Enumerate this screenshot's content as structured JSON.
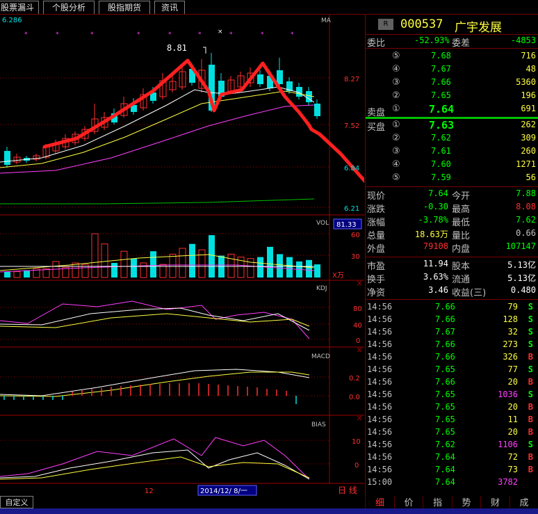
{
  "tabs": [
    "股票漏斗",
    "个股分析",
    "股指期货",
    "资讯"
  ],
  "chart": {
    "top_left_price": "6.286",
    "ma_label": "MA",
    "high_marker": "8.81",
    "y_prices": [
      "8.27",
      "7.52",
      "6.84",
      "6.21"
    ],
    "vol_label": "VOL",
    "vol_value": "81.33",
    "vol_ticks": [
      "60",
      "30"
    ],
    "vol_unit": "X万",
    "kdj_label": "KDJ",
    "kdj_ticks": [
      "80",
      "40",
      "0"
    ],
    "macd_label": "MACD",
    "macd_ticks": [
      "0.2",
      "0.0"
    ],
    "bias_label": "BIAS",
    "bias_ticks": [
      "10",
      "0"
    ],
    "x_label_mid": "12",
    "x_date": "2014/12/ 8/一",
    "period": "日 线",
    "custom": "自定义",
    "colors": {
      "up": "#ff3030",
      "down": "#00e0e0",
      "annot": "#ff2020",
      "ma1": "#ffffff",
      "ma2": "#ffff40",
      "ma3": "#ff40ff",
      "ma4": "#00c000"
    }
  },
  "quote": {
    "badge": "R",
    "code": "000537",
    "name": "广宇发展",
    "wb_label": "委比",
    "wb_value": "-52.93%",
    "wc_label": "委差",
    "wc_value": "-4853",
    "sell_label": "卖盘",
    "buy_label": "买盘",
    "sells": [
      {
        "idx": "⑤",
        "price": "7.68",
        "vol": "716"
      },
      {
        "idx": "④",
        "price": "7.67",
        "vol": "48"
      },
      {
        "idx": "③",
        "price": "7.66",
        "vol": "5360"
      },
      {
        "idx": "②",
        "price": "7.65",
        "vol": "196"
      },
      {
        "idx": "①",
        "price": "7.64",
        "vol": "691"
      }
    ],
    "buys": [
      {
        "idx": "①",
        "price": "7.63",
        "vol": "262"
      },
      {
        "idx": "②",
        "price": "7.62",
        "vol": "309"
      },
      {
        "idx": "③",
        "price": "7.61",
        "vol": "260"
      },
      {
        "idx": "④",
        "price": "7.60",
        "vol": "1271"
      },
      {
        "idx": "⑤",
        "price": "7.59",
        "vol": "56"
      }
    ],
    "stats": [
      {
        "l1": "现价",
        "v1": "7.64",
        "c1": "#00ff00",
        "l2": "今开",
        "v2": "7.88",
        "c2": "#00ff00"
      },
      {
        "l1": "涨跌",
        "v1": "-0.30",
        "c1": "#00ff00",
        "l2": "最高",
        "v2": "8.08",
        "c2": "#ff3030"
      },
      {
        "l1": "涨幅",
        "v1": "-3.78%",
        "c1": "#00ff00",
        "l2": "最低",
        "v2": "7.62",
        "c2": "#00ff00"
      },
      {
        "l1": "总量",
        "v1": "18.63万",
        "c1": "#ffff40",
        "l2": "量比",
        "v2": "0.66",
        "c2": "#c0c0c0"
      },
      {
        "l1": "外盘",
        "v1": "79108",
        "c1": "#ff3030",
        "l2": "内盘",
        "v2": "107147",
        "c2": "#00ff00"
      }
    ],
    "stats2": [
      {
        "l1": "市盈",
        "v1": "11.94",
        "l2": "股本",
        "v2": "5.13亿"
      },
      {
        "l1": "换手",
        "v1": "3.63%",
        "l2": "流通",
        "v2": "5.13亿"
      },
      {
        "l1": "净资",
        "v1": "3.46",
        "l2": "收益(三)",
        "v2": "0.480"
      }
    ],
    "ticks": [
      {
        "t": "14:56",
        "p": "7.66",
        "v": "79",
        "s": "S",
        "vc": "#ffff40"
      },
      {
        "t": "14:56",
        "p": "7.66",
        "v": "128",
        "s": "S",
        "vc": "#ffff40"
      },
      {
        "t": "14:56",
        "p": "7.67",
        "v": "32",
        "s": "S",
        "vc": "#ffff40"
      },
      {
        "t": "14:56",
        "p": "7.66",
        "v": "273",
        "s": "S",
        "vc": "#ffff40"
      },
      {
        "t": "14:56",
        "p": "7.66",
        "v": "326",
        "s": "B",
        "vc": "#ffff40"
      },
      {
        "t": "14:56",
        "p": "7.65",
        "v": "77",
        "s": "S",
        "vc": "#ffff40"
      },
      {
        "t": "14:56",
        "p": "7.66",
        "v": "20",
        "s": "B",
        "vc": "#ffff40"
      },
      {
        "t": "14:56",
        "p": "7.65",
        "v": "1036",
        "s": "S",
        "vc": "#ff40ff"
      },
      {
        "t": "14:56",
        "p": "7.65",
        "v": "20",
        "s": "B",
        "vc": "#ffff40"
      },
      {
        "t": "14:56",
        "p": "7.65",
        "v": "11",
        "s": "B",
        "vc": "#ffff40"
      },
      {
        "t": "14:56",
        "p": "7.65",
        "v": "20",
        "s": "B",
        "vc": "#ffff40"
      },
      {
        "t": "14:56",
        "p": "7.62",
        "v": "1106",
        "s": "S",
        "vc": "#ff40ff"
      },
      {
        "t": "14:56",
        "p": "7.64",
        "v": "72",
        "s": "B",
        "vc": "#ffff40"
      },
      {
        "t": "14:56",
        "p": "7.64",
        "v": "73",
        "s": "B",
        "vc": "#ffff40"
      },
      {
        "t": "15:00",
        "p": "7.64",
        "v": "3782",
        "s": "",
        "vc": "#ff40ff"
      }
    ],
    "bottom_tabs": [
      "细",
      "价",
      "指",
      "势",
      "财",
      "成"
    ]
  }
}
